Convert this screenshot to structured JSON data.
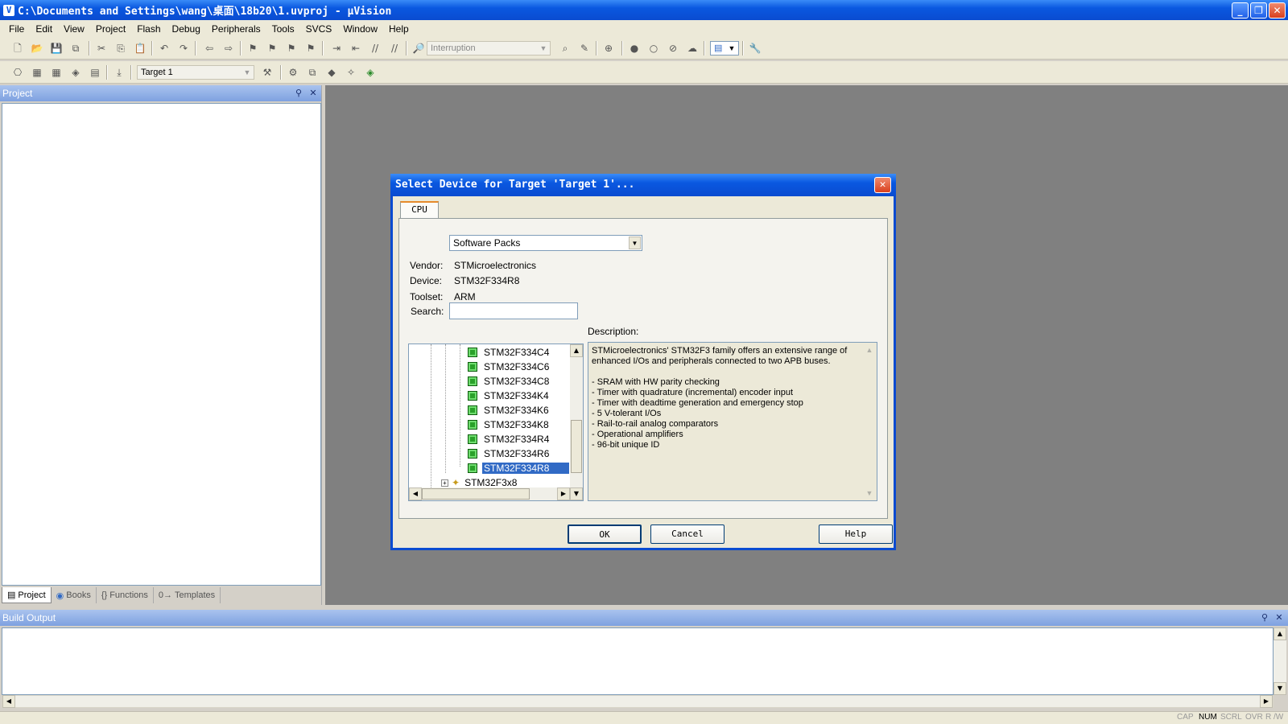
{
  "window": {
    "title": "C:\\Documents and Settings\\wang\\桌面\\18b20\\1.uvproj - µVision"
  },
  "menu": [
    "File",
    "Edit",
    "View",
    "Project",
    "Flash",
    "Debug",
    "Peripherals",
    "Tools",
    "SVCS",
    "Window",
    "Help"
  ],
  "toolbar": {
    "interrupt_combo": "Interruption",
    "target_combo": "Target 1"
  },
  "project_panel": {
    "title": "Project",
    "tabs": [
      "Project",
      "Books",
      "Functions",
      "Templates"
    ]
  },
  "build_output": {
    "title": "Build Output"
  },
  "statusbar": [
    "CAP",
    "NUM",
    "SCRL",
    "OVR",
    "R /W"
  ],
  "dialog": {
    "title": "Select Device for Target 'Target 1'...",
    "tab": "CPU",
    "source_combo": "Software Packs",
    "vendor_label": "Vendor:",
    "vendor_value": "STMicroelectronics",
    "device_label": "Device:",
    "device_value": "STM32F334R8",
    "toolset_label": "Toolset:",
    "toolset_value": "ARM",
    "search_label": "Search:",
    "search_value": "",
    "devices": [
      "STM32F334C4",
      "STM32F334C6",
      "STM32F334C8",
      "STM32F334K4",
      "STM32F334K6",
      "STM32F334K8",
      "STM32F334R4",
      "STM32F334R6",
      "STM32F334R8"
    ],
    "selected_device": "STM32F334R8",
    "group_item": "STM32F3x8",
    "description_label": "Description:",
    "description_lines": [
      "STMicroelectronics' STM32F3 family offers an extensive range of",
      "enhanced I/Os and peripherals connected to two APB buses.",
      "",
      " - SRAM with HW parity checking",
      " - Timer with quadrature (incremental) encoder input",
      " - Timer with deadtime generation and emergency stop",
      " - 5 V-tolerant I/Os",
      " - Rail-to-rail analog comparators",
      " - Operational amplifiers",
      " - 96-bit unique ID"
    ],
    "ok_label": "OK",
    "cancel_label": "Cancel",
    "help_label": "Help"
  }
}
